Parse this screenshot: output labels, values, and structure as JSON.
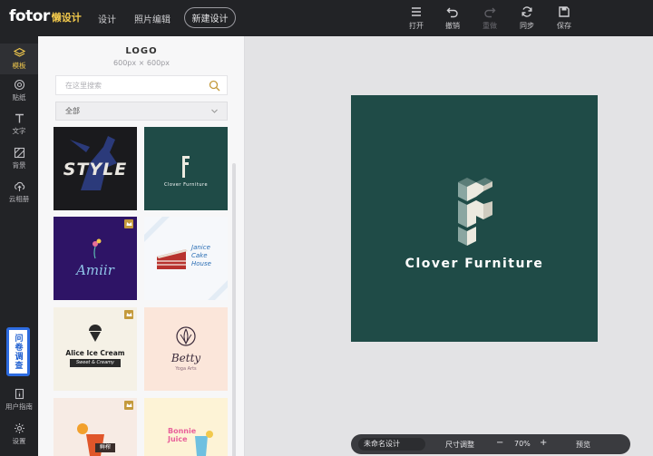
{
  "brand": {
    "logo_word": "fotor",
    "logo_sub": "懒设计"
  },
  "nav": {
    "design": "设计",
    "photo_edit": "照片编辑",
    "new_design": "新建设计"
  },
  "toolbar": {
    "open": "打开",
    "undo": "撤销",
    "redo": "重做",
    "sync": "同步",
    "save": "保存"
  },
  "rail": {
    "items": [
      {
        "label": "模板",
        "icon": "layers-icon"
      },
      {
        "label": "贴纸",
        "icon": "sticker-icon"
      },
      {
        "label": "文字",
        "icon": "text-icon"
      },
      {
        "label": "背景",
        "icon": "background-icon"
      },
      {
        "label": "云相册",
        "icon": "cloud-upload-icon"
      }
    ],
    "survey": "问卷调查",
    "guide": "用户指南",
    "settings": "设置"
  },
  "panel": {
    "title": "LOGO",
    "size": "600px × 600px",
    "search_placeholder": "在这里搜索",
    "filter": "全部",
    "thumbs": {
      "t1": "STYLE",
      "t2": "Clover Furniture",
      "t3": "Amiir",
      "t4_lines": [
        "Janice",
        "Cake",
        "House"
      ],
      "t5_title": "Alice Ice Cream",
      "t5_sub": "Sweet & Creamy",
      "t6_title": "Betty",
      "t6_sub": "Yoga Arts",
      "t7": "鲜榨",
      "t8_lines": [
        "Bonnie",
        "Juice"
      ]
    }
  },
  "canvas": {
    "brand_name": "Clover Furniture"
  },
  "bottom": {
    "doc_name": "未命名设计",
    "resize": "尺寸调整",
    "minus": "−",
    "zoom": "70%",
    "plus": "+",
    "preview": "预览"
  },
  "colors": {
    "dark": "#222326",
    "accent": "#f2c94c",
    "canvas_bg": "#1f4b47",
    "survey_border": "#2d6be0"
  }
}
